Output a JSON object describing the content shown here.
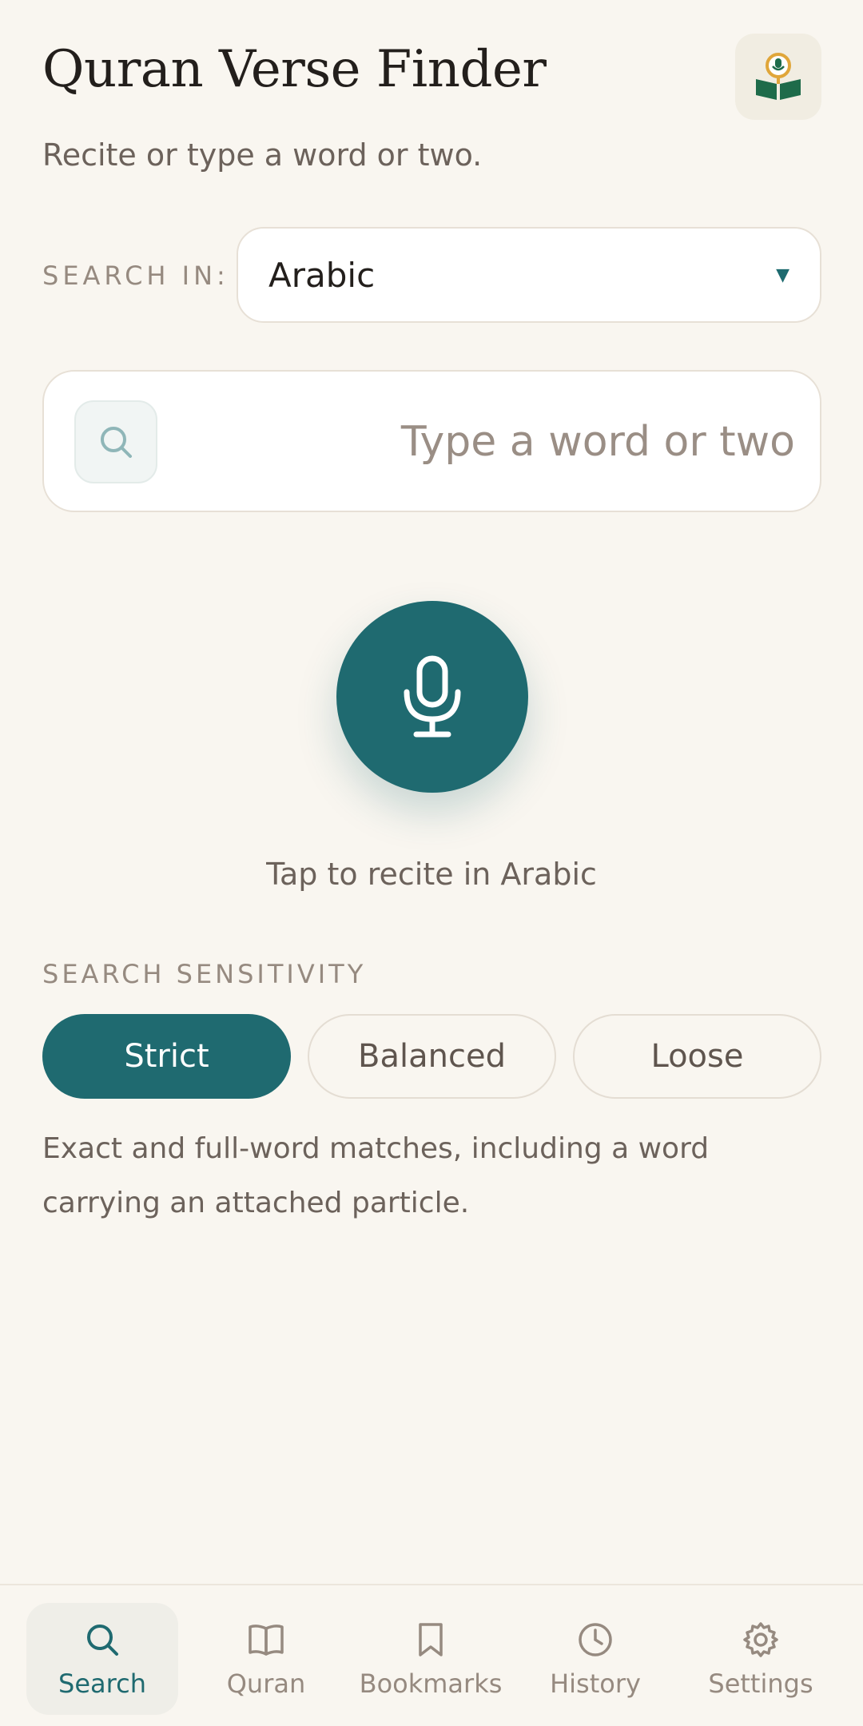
{
  "header": {
    "title": "Quran Verse Finder",
    "subtitle": "Recite or type a word or two."
  },
  "search_in": {
    "label": "SEARCH IN:",
    "selected": "Arabic"
  },
  "search": {
    "placeholder": "Type a word or two",
    "value": ""
  },
  "mic": {
    "caption": "Tap to recite in Arabic"
  },
  "sensitivity": {
    "label": "SEARCH SENSITIVITY",
    "options": [
      "Strict",
      "Balanced",
      "Loose"
    ],
    "selected": "Strict",
    "description": "Exact and full-word matches, including a word carrying an attached particle."
  },
  "nav": {
    "items": [
      {
        "label": "Search",
        "icon": "search-icon"
      },
      {
        "label": "Quran",
        "icon": "book-icon"
      },
      {
        "label": "Bookmarks",
        "icon": "bookmark-icon"
      },
      {
        "label": "History",
        "icon": "clock-icon"
      },
      {
        "label": "Settings",
        "icon": "gear-icon"
      }
    ],
    "active": "Search"
  },
  "colors": {
    "background": "#f9f6f0",
    "accent": "#1f6a70",
    "muted_text": "#968a80",
    "logo_green": "#1e6b4a"
  }
}
